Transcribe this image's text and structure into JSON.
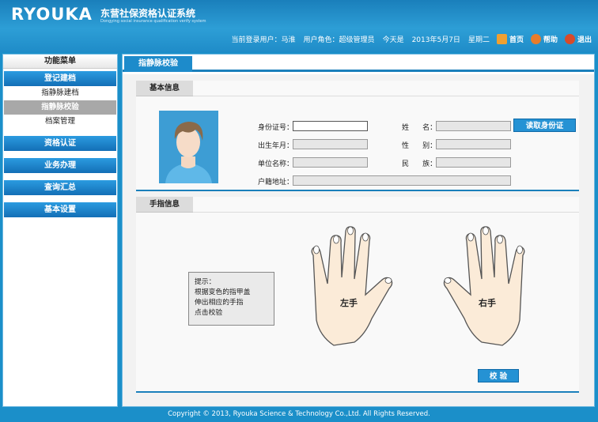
{
  "header": {
    "logo": "RYOUKA",
    "title_cn": "东营社保资格认证系统",
    "title_en": "Dongying social insurance qualification verify system",
    "current_user_label": "当前登录用户：",
    "current_user": "马淮",
    "role_label": "用户角色：",
    "role": "超级管理员",
    "today_label": "今天是",
    "date": "2013年5月7日",
    "weekday": "星期二",
    "home": "首页",
    "help": "帮助",
    "exit": "退出"
  },
  "sidebar": {
    "title": "功能菜单",
    "groups": [
      {
        "label": "登记建档",
        "items": [
          "指静脉建档",
          "指静脉校验",
          "档案管理"
        ]
      },
      {
        "label": "资格认证"
      },
      {
        "label": "业务办理"
      },
      {
        "label": "查询汇总"
      },
      {
        "label": "基本设置"
      }
    ]
  },
  "main": {
    "tab": "指静脉校验",
    "basic": {
      "title": "基本信息",
      "id_label": "身份证号：",
      "name_label": "姓      名：",
      "birth_label": "出生年月：",
      "gender_label": "性      别：",
      "unit_label": "单位名称：",
      "ethnic_label": "民      族：",
      "address_label": "户籍地址：",
      "read_button": "读取身份证"
    },
    "finger": {
      "title": "手指信息",
      "tip_lines": [
        "提示：",
        "根据变色的指甲盖",
        "伸出相应的手指",
        "点击校验"
      ],
      "left_hand": "左手",
      "right_hand": "右手",
      "check_button": "校  验"
    }
  },
  "footer": "Copyright © 2013, Ryouka Science & Technology Co.,Ltd. All Rights Reserved.",
  "colors": {
    "accent": "#1d8bcb",
    "header": "#1f8cc8",
    "hand_fill": "#fbebd8",
    "hand_stroke": "#555555"
  }
}
